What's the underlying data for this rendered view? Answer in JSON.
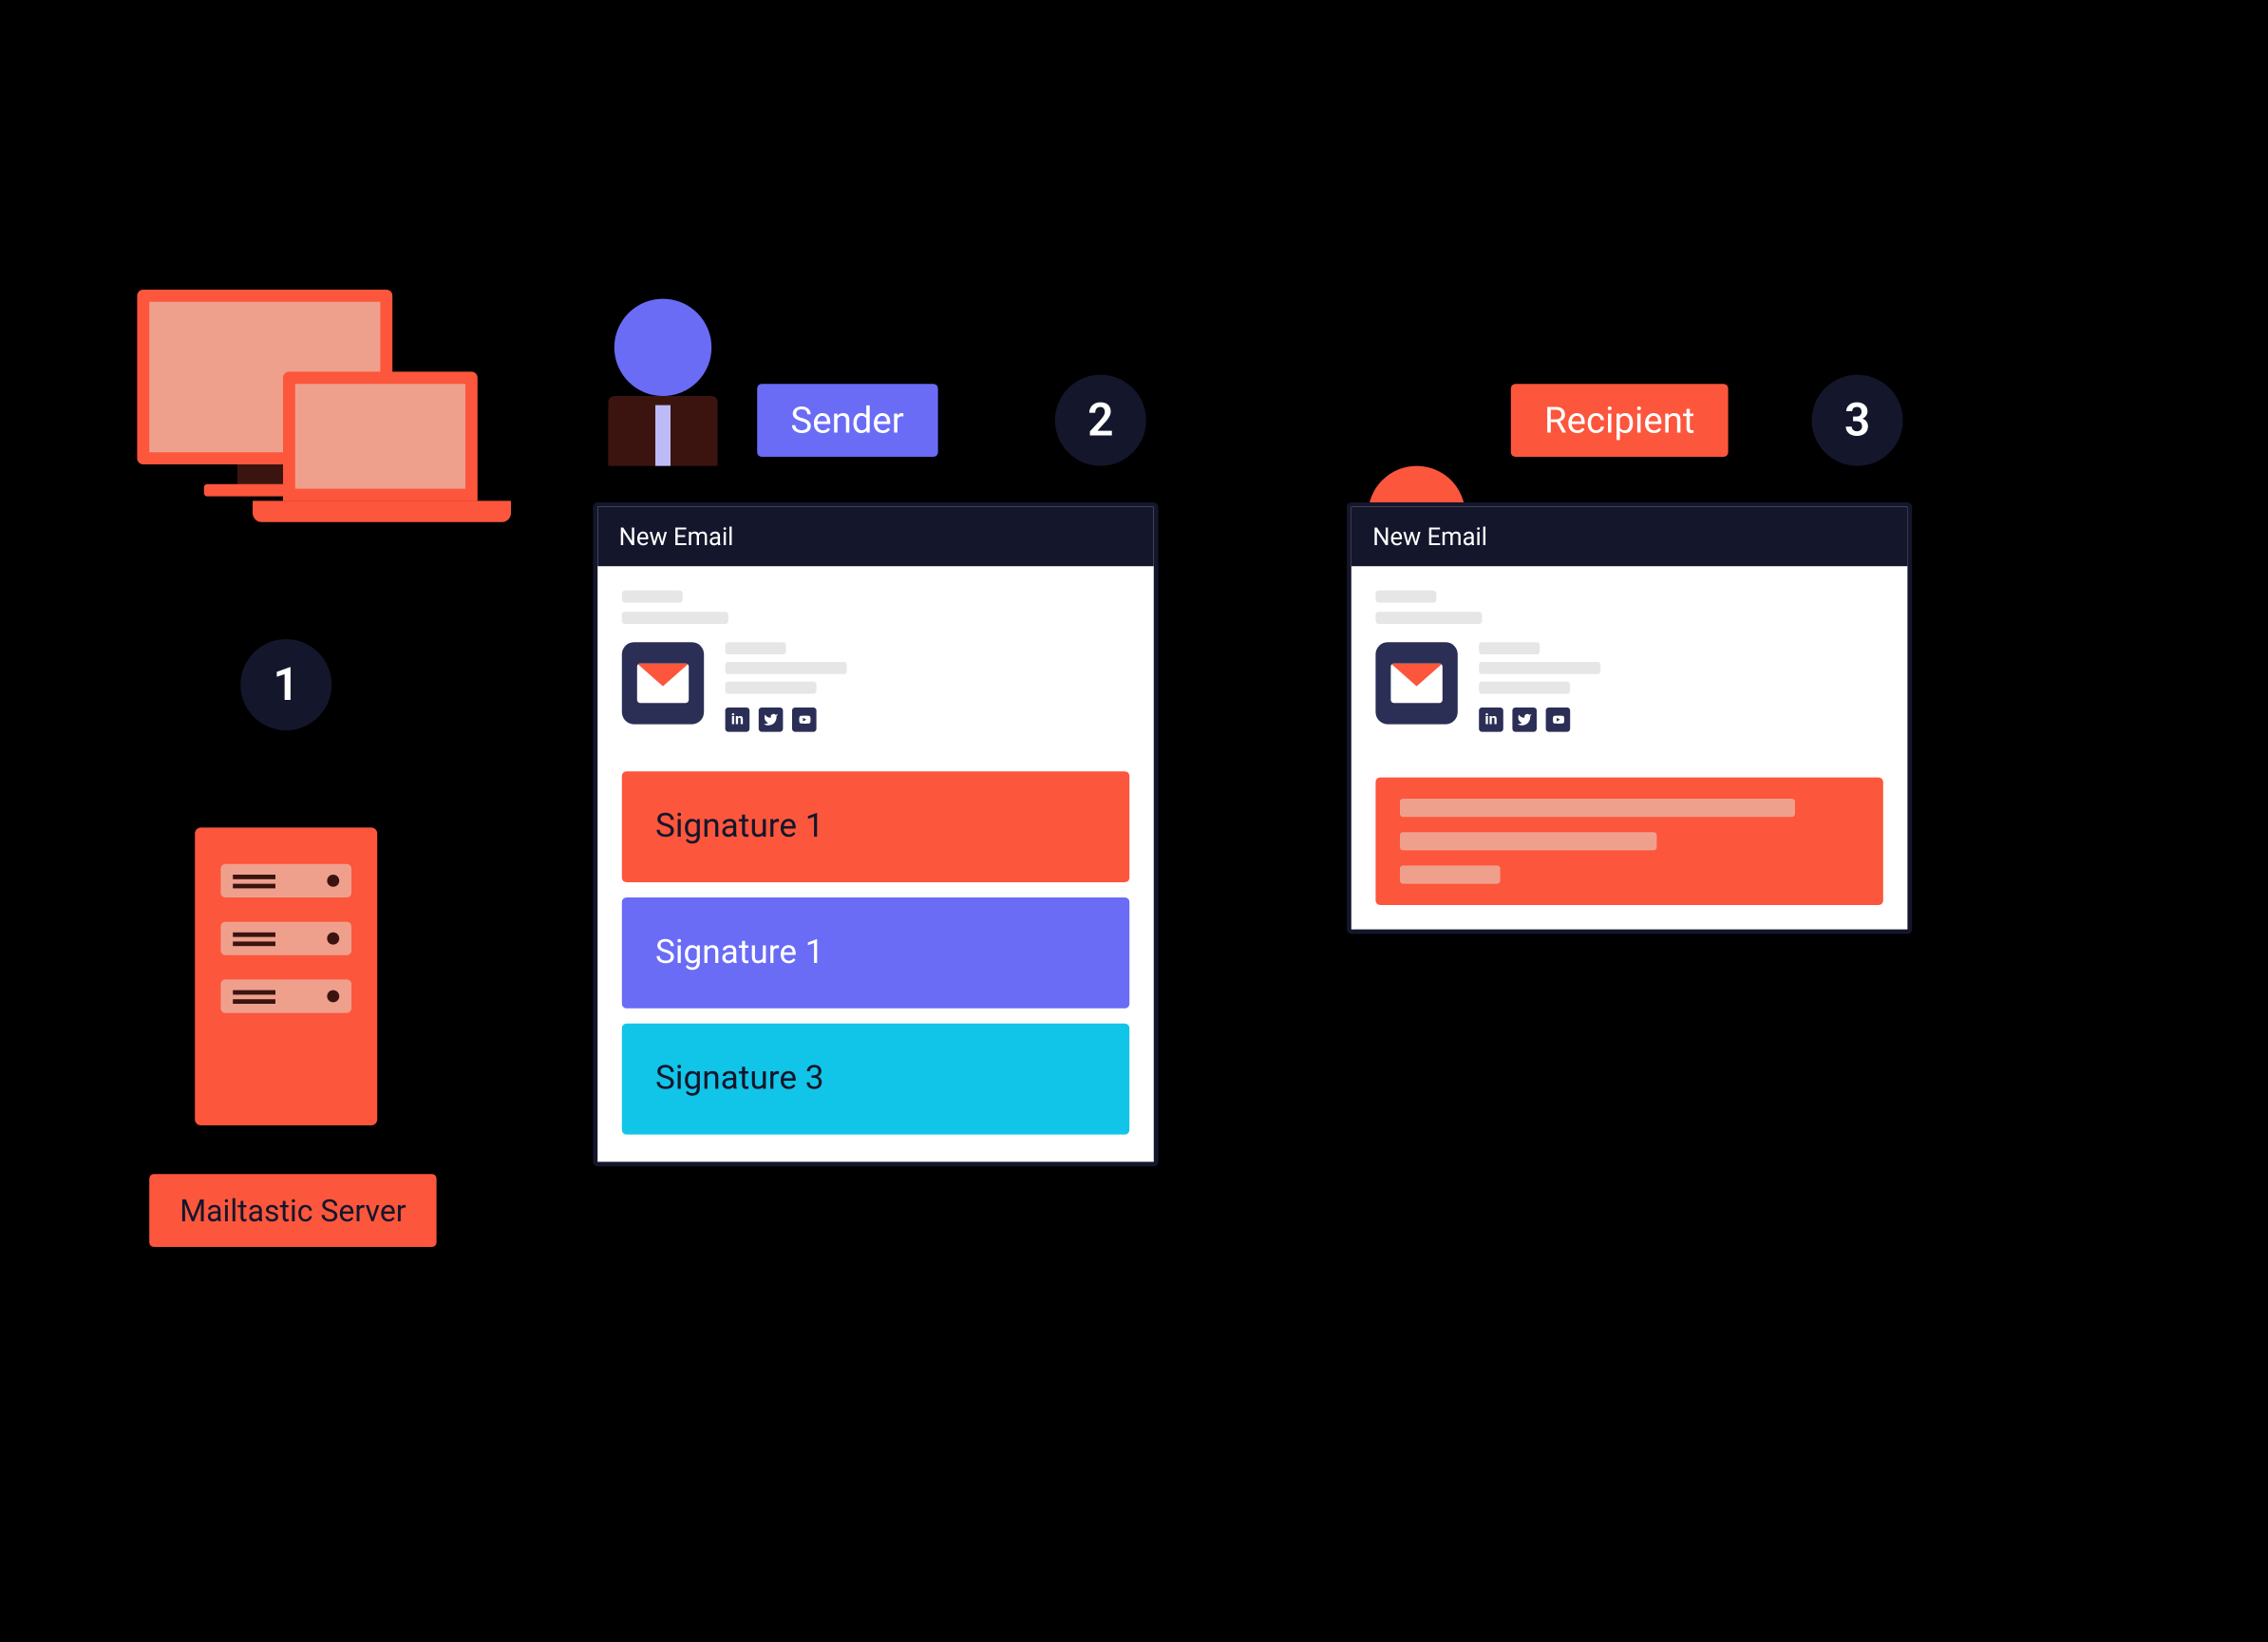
{
  "steps": {
    "step1": "1",
    "step2": "2",
    "step3": "3"
  },
  "server": {
    "label": "Mailtastic Server"
  },
  "roles": {
    "sender": "Sender",
    "recipient": "Recipient"
  },
  "email": {
    "title": "New Email"
  },
  "signatures": {
    "options": [
      {
        "label": "Signature 1",
        "color": "#fc563c"
      },
      {
        "label": "Signature 1",
        "color": "#6a6cf6"
      },
      {
        "label": "Signature 3",
        "color": "#11c5e8"
      }
    ]
  },
  "social_icons": [
    "linkedin",
    "twitter",
    "youtube"
  ]
}
